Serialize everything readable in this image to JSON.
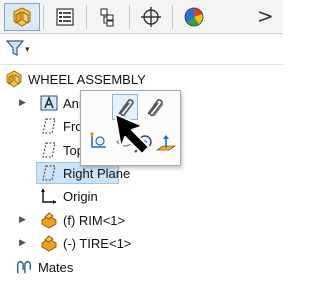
{
  "toolbar": {
    "tabs": [
      {
        "name": "feature-manager",
        "active": true
      },
      {
        "name": "property-manager",
        "active": false
      },
      {
        "name": "configuration-manager",
        "active": false
      },
      {
        "name": "dimxpert-manager",
        "active": false
      },
      {
        "name": "display-manager",
        "active": false
      }
    ],
    "overflow_glyph": ">"
  },
  "filter": {
    "icon": "funnel-icon",
    "caret": "▾"
  },
  "tree": {
    "root_label": "WHEEL ASSEMBLY",
    "items": [
      {
        "label": "Annot",
        "icon": "annotations-icon",
        "expandable": true
      },
      {
        "label": "Front",
        "icon": "plane-icon",
        "expandable": false
      },
      {
        "label": "Top P",
        "icon": "plane-icon",
        "expandable": false
      },
      {
        "label": "Right Plane",
        "icon": "plane-icon",
        "expandable": false,
        "selected": true
      },
      {
        "label": "Origin",
        "icon": "origin-icon",
        "expandable": false
      },
      {
        "label": "(f) RIM<1>",
        "icon": "part-icon",
        "expandable": true
      },
      {
        "label": "(-) TIRE<1>",
        "icon": "part-icon",
        "expandable": true
      },
      {
        "label": "Mates",
        "icon": "mates-icon",
        "expandable": false
      }
    ],
    "expand_glyph": "▶"
  },
  "popup": {
    "buttons": [
      "mate-icon",
      "smart-mate-icon",
      "sketch-icon",
      "hide-icon",
      "zoom-to-selection-icon",
      "normal-to-icon"
    ]
  },
  "colors": {
    "part_orange": "#f0a01e",
    "assembly_yellow": "#f5c64a",
    "selection_bg": "#cce4f7",
    "selection_border": "#99c9ef"
  }
}
